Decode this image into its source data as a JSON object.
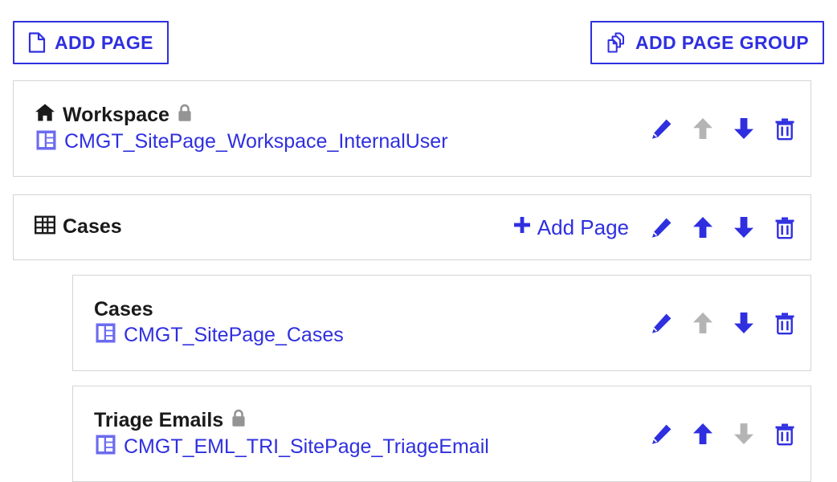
{
  "colors": {
    "accent_blue": "#2f2fe0",
    "disabled_gray": "#b4b4b4",
    "lock_gray": "#949494",
    "title_black": "#1a1a1a",
    "card_border": "#d4d4d4",
    "page_icon_fill": "#6b6bf0"
  },
  "toolbar": {
    "add_page_label": "ADD PAGE",
    "add_page_icon": "document-icon",
    "add_page_group_label": "ADD PAGE GROUP",
    "add_page_group_icon": "copy-pages-icon"
  },
  "actions": {
    "edit_label": "Edit",
    "move_up_label": "Move Up",
    "move_down_label": "Move Down",
    "delete_label": "Delete",
    "edit_icon": "pencil-icon",
    "move_up_icon": "arrow-up-icon",
    "move_down_icon": "arrow-down-icon",
    "delete_icon": "trash-icon",
    "add_page_inline_label": "Add Page",
    "add_page_inline_icon": "plus-icon"
  },
  "rows": [
    {
      "type": "page",
      "nested": false,
      "leading_icon": "home-icon",
      "title": "Workspace",
      "locked": true,
      "lock_icon": "lock-icon",
      "page_icon": "page-layout-icon",
      "page_name": "CMGT_SitePage_Workspace_InternalUser",
      "has_add_page": false,
      "edit_enabled": true,
      "move_up_enabled": false,
      "move_down_enabled": true,
      "delete_enabled": true
    },
    {
      "type": "group",
      "nested": false,
      "leading_icon": "table-grid-icon",
      "title": "Cases",
      "locked": false,
      "page_icon": null,
      "page_name": null,
      "has_add_page": true,
      "edit_enabled": true,
      "move_up_enabled": true,
      "move_down_enabled": true,
      "delete_enabled": true
    },
    {
      "type": "page",
      "nested": true,
      "leading_icon": null,
      "title": "Cases",
      "locked": false,
      "lock_icon": null,
      "page_icon": "page-layout-icon",
      "page_name": "CMGT_SitePage_Cases",
      "has_add_page": false,
      "edit_enabled": true,
      "move_up_enabled": false,
      "move_down_enabled": true,
      "delete_enabled": true
    },
    {
      "type": "page",
      "nested": true,
      "leading_icon": null,
      "title": "Triage Emails",
      "locked": true,
      "lock_icon": "lock-icon",
      "page_icon": "page-layout-icon",
      "page_name": "CMGT_EML_TRI_SitePage_TriageEmail",
      "has_add_page": false,
      "edit_enabled": true,
      "move_up_enabled": true,
      "move_down_enabled": false,
      "delete_enabled": true
    }
  ]
}
